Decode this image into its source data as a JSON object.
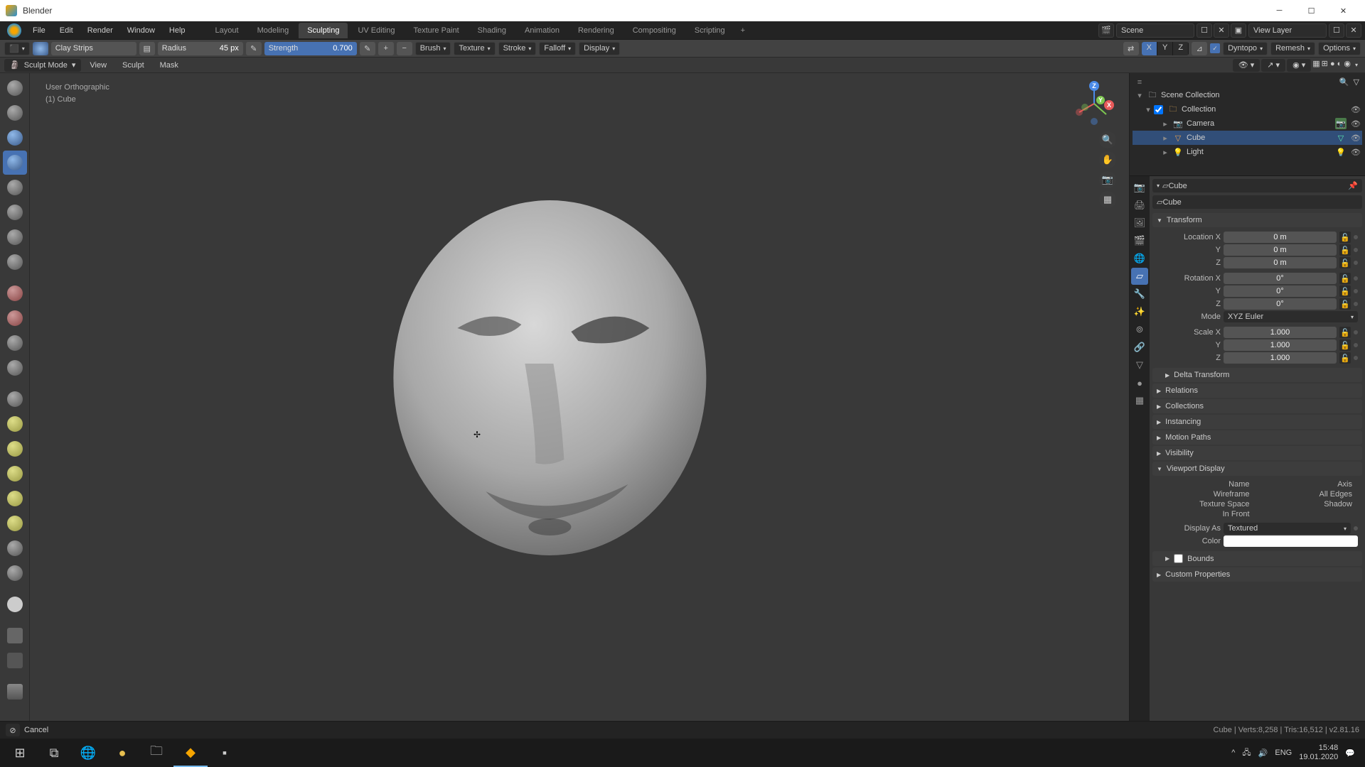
{
  "window": {
    "title": "Blender"
  },
  "menus": [
    "File",
    "Edit",
    "Render",
    "Window",
    "Help"
  ],
  "workspace_tabs": [
    "Layout",
    "Modeling",
    "Sculpting",
    "UV Editing",
    "Texture Paint",
    "Shading",
    "Animation",
    "Rendering",
    "Compositing",
    "Scripting"
  ],
  "workspace_active": 2,
  "topbar_scene": "Scene",
  "topbar_layer": "View Layer",
  "toolheader": {
    "brush_name": "Clay Strips",
    "radius_label": "Radius",
    "radius_value": "45 px",
    "strength_label": "Strength",
    "strength_value": "0.700",
    "mirror_label": "X  Y  Z",
    "dropdowns": [
      "Brush",
      "Texture",
      "Stroke",
      "Falloff",
      "Display"
    ],
    "right": [
      "Dyntopo",
      "Remesh",
      "Options"
    ]
  },
  "submenu": {
    "mode": "Sculpt Mode",
    "items": [
      "View",
      "Sculpt",
      "Mask"
    ]
  },
  "viewport": {
    "info1": "User Orthographic",
    "info2": "(1) Cube"
  },
  "outliner": {
    "root": "Scene Collection",
    "collection": "Collection",
    "items": [
      {
        "name": "Camera",
        "type": "camera"
      },
      {
        "name": "Cube",
        "type": "mesh",
        "selected": true
      },
      {
        "name": "Light",
        "type": "light"
      }
    ]
  },
  "props": {
    "crumb": "Cube",
    "crumb2": "Cube",
    "sections": {
      "transform": "Transform",
      "delta": "Delta Transform",
      "relations": "Relations",
      "collections": "Collections",
      "instancing": "Instancing",
      "motion": "Motion Paths",
      "visibility": "Visibility",
      "viewport": "Viewport Display",
      "bounds": "Bounds",
      "custom": "Custom Properties"
    },
    "transform": {
      "loc_label": "Location X",
      "loc_x": "0 m",
      "loc_y": "0 m",
      "loc_z": "0 m",
      "rot_label": "Rotation X",
      "rot_x": "0°",
      "rot_y": "0°",
      "rot_z": "0°",
      "rot_mode_label": "Mode",
      "rot_mode": "XYZ Euler",
      "scale_label": "Scale X",
      "scale_x": "1.000",
      "scale_y": "1.000",
      "scale_z": "1.000",
      "y_label": "Y",
      "z_label": "Z"
    },
    "viewport_disp": {
      "name_label": "Name",
      "axis_label": "Axis",
      "wire_label": "Wireframe",
      "edges_label": "All Edges",
      "tex_label": "Texture Space",
      "shadow_label": "Shadow",
      "front_label": "In Front",
      "display_as_label": "Display As",
      "display_as": "Textured",
      "color_label": "Color"
    }
  },
  "status": {
    "left": "Cancel",
    "right": "Cube | Verts:8,258 | Tris:16,512 | v2.81.16"
  },
  "taskbar": {
    "lang": "ENG",
    "time": "15:48",
    "date": "19.01.2020"
  }
}
